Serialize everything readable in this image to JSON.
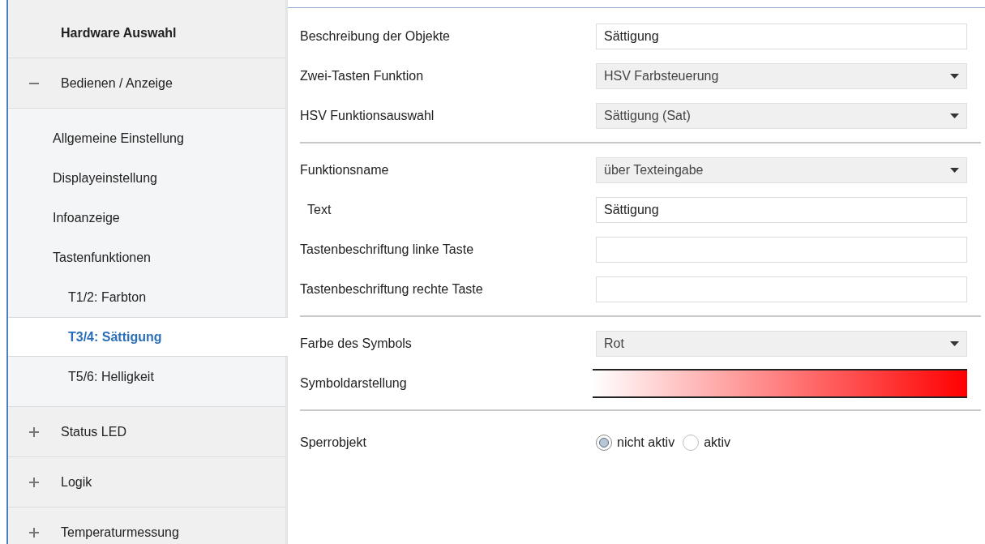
{
  "sidebar": {
    "items": [
      {
        "label": "Hardware Auswahl",
        "kind": "header"
      },
      {
        "label": "Bedienen / Anzeige",
        "kind": "group",
        "expanded": true,
        "children": [
          {
            "label": "Allgemeine Einstellung",
            "selected": false
          },
          {
            "label": "Displayeinstellung",
            "selected": false
          },
          {
            "label": "Infoanzeige",
            "selected": false
          },
          {
            "label": "Tastenfunktionen",
            "selected": false,
            "children": [
              {
                "label": "T1/2: Farbton",
                "selected": false
              },
              {
                "label": "T3/4: Sättigung",
                "selected": true
              },
              {
                "label": "T5/6: Helligkeit",
                "selected": false
              }
            ]
          }
        ]
      },
      {
        "label": "Status LED",
        "kind": "group",
        "expanded": false
      },
      {
        "label": "Logik",
        "kind": "group",
        "expanded": false
      },
      {
        "label": "Temperaturmessung",
        "kind": "group",
        "expanded": false
      }
    ]
  },
  "sections": [
    {
      "rows": [
        {
          "kind": "text",
          "label": "Beschreibung der Objekte",
          "value": "Sättigung"
        },
        {
          "kind": "select",
          "label": "Zwei-Tasten Funktion",
          "value": "HSV Farbsteuerung"
        },
        {
          "kind": "select",
          "label": "HSV Funktionsauswahl",
          "value": "Sättigung (Sat)"
        }
      ]
    },
    {
      "rows": [
        {
          "kind": "select",
          "label": "Funktionsname",
          "value": "über Texteingabe",
          "children": [
            {
              "kind": "text",
              "label": "Text",
              "value": "Sättigung"
            }
          ]
        },
        {
          "kind": "text",
          "label": "Tastenbeschriftung linke Taste"
        },
        {
          "kind": "text",
          "label": "Tastenbeschriftung rechte Taste"
        }
      ]
    },
    {
      "rows": [
        {
          "kind": "select",
          "label": "Farbe des Symbols",
          "value": "Rot"
        },
        {
          "kind": "gradient",
          "label": "Symboldarstellung",
          "color": "#ff0000"
        }
      ]
    },
    {
      "rows": [
        {
          "kind": "radio",
          "label": "Sperrobjekt",
          "options": [
            {
              "label": "nicht aktiv",
              "selected": true
            },
            {
              "label": "aktiv",
              "selected": false
            }
          ]
        }
      ]
    }
  ]
}
